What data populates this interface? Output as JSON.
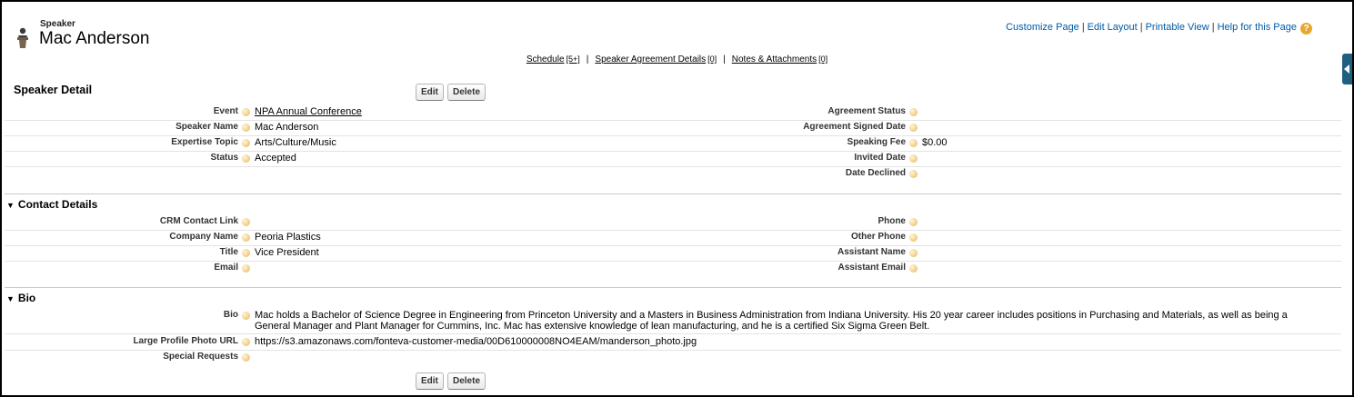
{
  "header": {
    "object_label": "Speaker",
    "record_name": "Mac Anderson",
    "icon": "speaker-podium-icon"
  },
  "top_links": {
    "customize": "Customize Page",
    "edit_layout": "Edit Layout",
    "printable": "Printable View",
    "help": "Help for this Page",
    "help_icon": "?"
  },
  "related_lists": [
    {
      "label": "Schedule",
      "count": "[5+]"
    },
    {
      "label": "Speaker Agreement Details",
      "count": "[0]"
    },
    {
      "label": "Notes & Attachments",
      "count": "[0]"
    }
  ],
  "related_sep": "|",
  "detail": {
    "title": "Speaker Detail",
    "edit_label": "Edit",
    "delete_label": "Delete",
    "left": [
      {
        "label": "Event",
        "value": "NPA Annual Conference"
      },
      {
        "label": "Speaker Name",
        "value": "Mac Anderson"
      },
      {
        "label": "Expertise Topic",
        "value": "Arts/Culture/Music"
      },
      {
        "label": "Status",
        "value": "Accepted"
      }
    ],
    "right": [
      {
        "label": "Agreement Status",
        "value": ""
      },
      {
        "label": "Agreement Signed Date",
        "value": ""
      },
      {
        "label": "Speaking Fee",
        "value": "$0.00"
      },
      {
        "label": "Invited Date",
        "value": ""
      },
      {
        "label": "Date Declined",
        "value": ""
      }
    ]
  },
  "contact": {
    "title": "Contact Details",
    "left": [
      {
        "label": "CRM Contact Link",
        "value": ""
      },
      {
        "label": "Company Name",
        "value": "Peoria Plastics"
      },
      {
        "label": "Title",
        "value": "Vice President"
      },
      {
        "label": "Email",
        "value": ""
      }
    ],
    "right": [
      {
        "label": "Phone",
        "value": ""
      },
      {
        "label": "Other Phone",
        "value": ""
      },
      {
        "label": "Assistant Name",
        "value": ""
      },
      {
        "label": "Assistant Email",
        "value": ""
      }
    ]
  },
  "bio": {
    "title": "Bio",
    "rows": [
      {
        "label": "Bio",
        "value": "Mac holds a Bachelor of Science Degree in Engineering from Princeton University and a Masters in Business Administration from Indiana University. His 20 year career includes positions in Purchasing and Materials, as well as being a General Manager and Plant Manager for Cummins, Inc. Mac has extensive knowledge of lean manufacturing, and he is a certified Six Sigma Green Belt."
      },
      {
        "label": "Large Profile Photo URL",
        "value": "https://s3.amazonaws.com/fonteva-customer-media/00D610000008NO4EAM/manderson_photo.jpg"
      },
      {
        "label": "Special Requests",
        "value": ""
      }
    ]
  },
  "colors": {
    "link": "#015ba7",
    "help": "#e8a82c",
    "sidebar_tab": "#1f5f80"
  }
}
